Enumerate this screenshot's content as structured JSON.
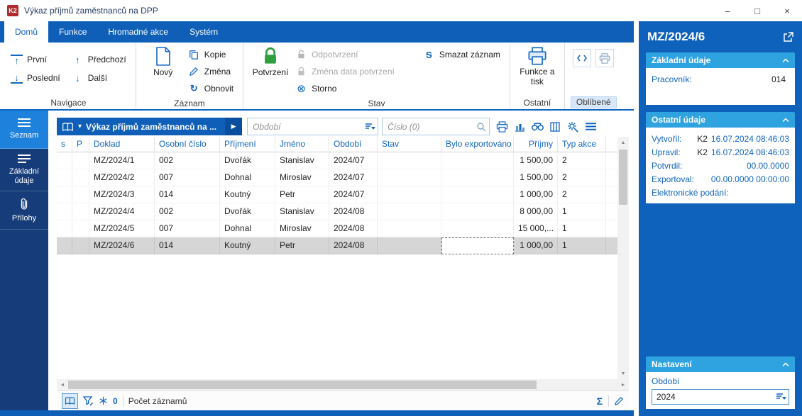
{
  "window": {
    "title": "Výkaz příjmů zaměstnanců na DPP",
    "app_initials": "K2"
  },
  "glyphs": {
    "minimize": "–",
    "maximize": "□",
    "close": "×",
    "up": "↑",
    "down": "↓",
    "play": "▶",
    "chevron_down": "▾",
    "refresh": "↻",
    "storno": "⊗",
    "smazat_s": "S",
    "sigma": "Σ",
    "tri_up": "▲",
    "tri_down": "▼",
    "tri_left": "◄",
    "tri_right": "►"
  },
  "tabs": [
    {
      "label": "Domů"
    },
    {
      "label": "Funkce"
    },
    {
      "label": "Hromadné akce"
    },
    {
      "label": "Systém"
    }
  ],
  "ribbon": {
    "navigace": {
      "label": "Navigace",
      "prvni": "První",
      "posledni": "Poslední",
      "predchozi": "Předchozí",
      "dalsi": "Další"
    },
    "zaznam": {
      "label": "Záznam",
      "novy": "Nový",
      "kopie": "Kopie",
      "zmena": "Změna",
      "obnovit": "Obnovit"
    },
    "stav": {
      "label": "Stav",
      "potvrzeni": "Potvrzení",
      "odpotvrzeni": "Odpotvrzení",
      "zmena_data": "Změna data potvrzení",
      "storno": "Storno",
      "smazat": "Smazat záznam"
    },
    "ostatni": {
      "label": "Ostatní",
      "funkce_a_tisk": "Funkce a tisk"
    },
    "oblibene": {
      "label": "Oblíbené"
    }
  },
  "sidebar": {
    "seznam": "Seznam",
    "zakladni_udaje": "Základní údaje",
    "prilohy": "Přílohy"
  },
  "browser": {
    "title": "Výkaz příjmů zaměstnanců na ...",
    "obdobi_placeholder": "Období",
    "cislo_placeholder": "Číslo (0)",
    "columns": [
      "s",
      "P",
      "Doklad",
      "Osobní číslo",
      "Příjmení",
      "Jméno",
      "Období",
      "Stav",
      "Bylo exportováno",
      "Příjmy",
      "Typ akce"
    ],
    "rows": [
      [
        "",
        "",
        "MZ/2024/1",
        "002",
        "Dvořák",
        "Stanislav",
        "2024/07",
        "",
        "",
        "1 500,00",
        "2"
      ],
      [
        "",
        "",
        "MZ/2024/2",
        "007",
        "Dohnal",
        "Miroslav",
        "2024/07",
        "",
        "",
        "1 500,00",
        "2"
      ],
      [
        "",
        "",
        "MZ/2024/3",
        "014",
        "Koutný",
        "Petr",
        "2024/07",
        "",
        "",
        "1 000,00",
        "2"
      ],
      [
        "",
        "",
        "MZ/2024/4",
        "002",
        "Dvořák",
        "Stanislav",
        "2024/08",
        "",
        "",
        "8 000,00",
        "1"
      ],
      [
        "",
        "",
        "MZ/2024/5",
        "007",
        "Dohnal",
        "Miroslav",
        "2024/08",
        "",
        "",
        "15 000,...",
        "1"
      ],
      [
        "",
        "",
        "MZ/2024/6",
        "014",
        "Koutný",
        "Petr",
        "2024/08",
        "",
        "",
        "1 000,00",
        "1"
      ]
    ],
    "selected_row": 5,
    "focused_cell_col": 8,
    "status": {
      "frozen_count": "0",
      "count_label": "Počet záznamů"
    }
  },
  "detail": {
    "title": "MZ/2024/6",
    "zakladni": {
      "title": "Základní údaje",
      "pracovnik_label": "Pracovník:",
      "pracovnik_value": "014"
    },
    "ostatni": {
      "title": "Ostatní údaje",
      "fields": [
        {
          "label": "Vytvořil:",
          "user": "K2",
          "date": "16.07.2024 08:46:03"
        },
        {
          "label": "Upravil:",
          "user": "K2",
          "date": "16.07.2024 08:46:03"
        },
        {
          "label": "Potvrdil:",
          "user": "",
          "date": "00.00.0000"
        },
        {
          "label": "Exportoval:",
          "user": "",
          "date": "00.00.0000 00:00:00"
        },
        {
          "label": "Elektronické podání:",
          "user": "",
          "date": ""
        }
      ]
    },
    "nastaveni": {
      "title": "Nastavení",
      "obdobi_label": "Období",
      "obdobi_value": "2024"
    }
  }
}
